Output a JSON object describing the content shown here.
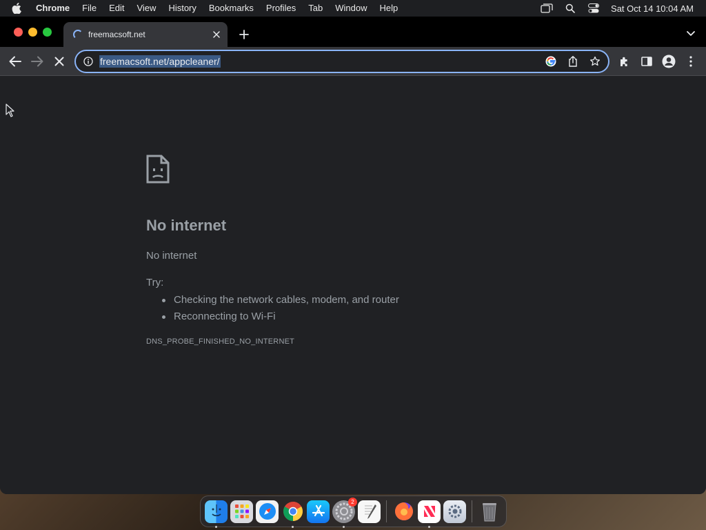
{
  "menubar": {
    "app_name": "Chrome",
    "items": [
      "File",
      "Edit",
      "View",
      "History",
      "Bookmarks",
      "Profiles",
      "Tab",
      "Window",
      "Help"
    ],
    "clock": "Sat Oct 14  10:04 AM",
    "status_icons": [
      "screen-mirroring-icon",
      "spotlight-search-icon",
      "control-center-icon"
    ]
  },
  "browser": {
    "tab": {
      "title": "freemacsoft.net",
      "loading": true
    },
    "omnibox": {
      "url": "freemacsoft.net/appcleaner/"
    }
  },
  "error_page": {
    "title": "No internet",
    "subtitle": "No internet",
    "try_label": "Try:",
    "suggestions": [
      "Checking the network cables, modem, and router",
      "Reconnecting to Wi-Fi"
    ],
    "error_code": "DNS_PROBE_FINISHED_NO_INTERNET"
  },
  "dock": {
    "items": [
      {
        "name": "finder",
        "running": true
      },
      {
        "name": "launchpad",
        "running": false
      },
      {
        "name": "safari",
        "running": false
      },
      {
        "name": "chrome",
        "running": true
      },
      {
        "name": "app-store",
        "running": false
      },
      {
        "name": "system-preferences",
        "running": true,
        "badge": "2"
      },
      {
        "name": "textedit",
        "running": false
      },
      {
        "name": "firefox",
        "running": false
      },
      {
        "name": "news",
        "running": true
      },
      {
        "name": "settings-utility",
        "running": false
      },
      {
        "name": "trash",
        "running": false
      }
    ]
  },
  "colors": {
    "accent": "#8ab4f8",
    "page_bg": "#202124",
    "toolbar_bg": "#35363a",
    "text_muted": "#9aa0a6"
  }
}
